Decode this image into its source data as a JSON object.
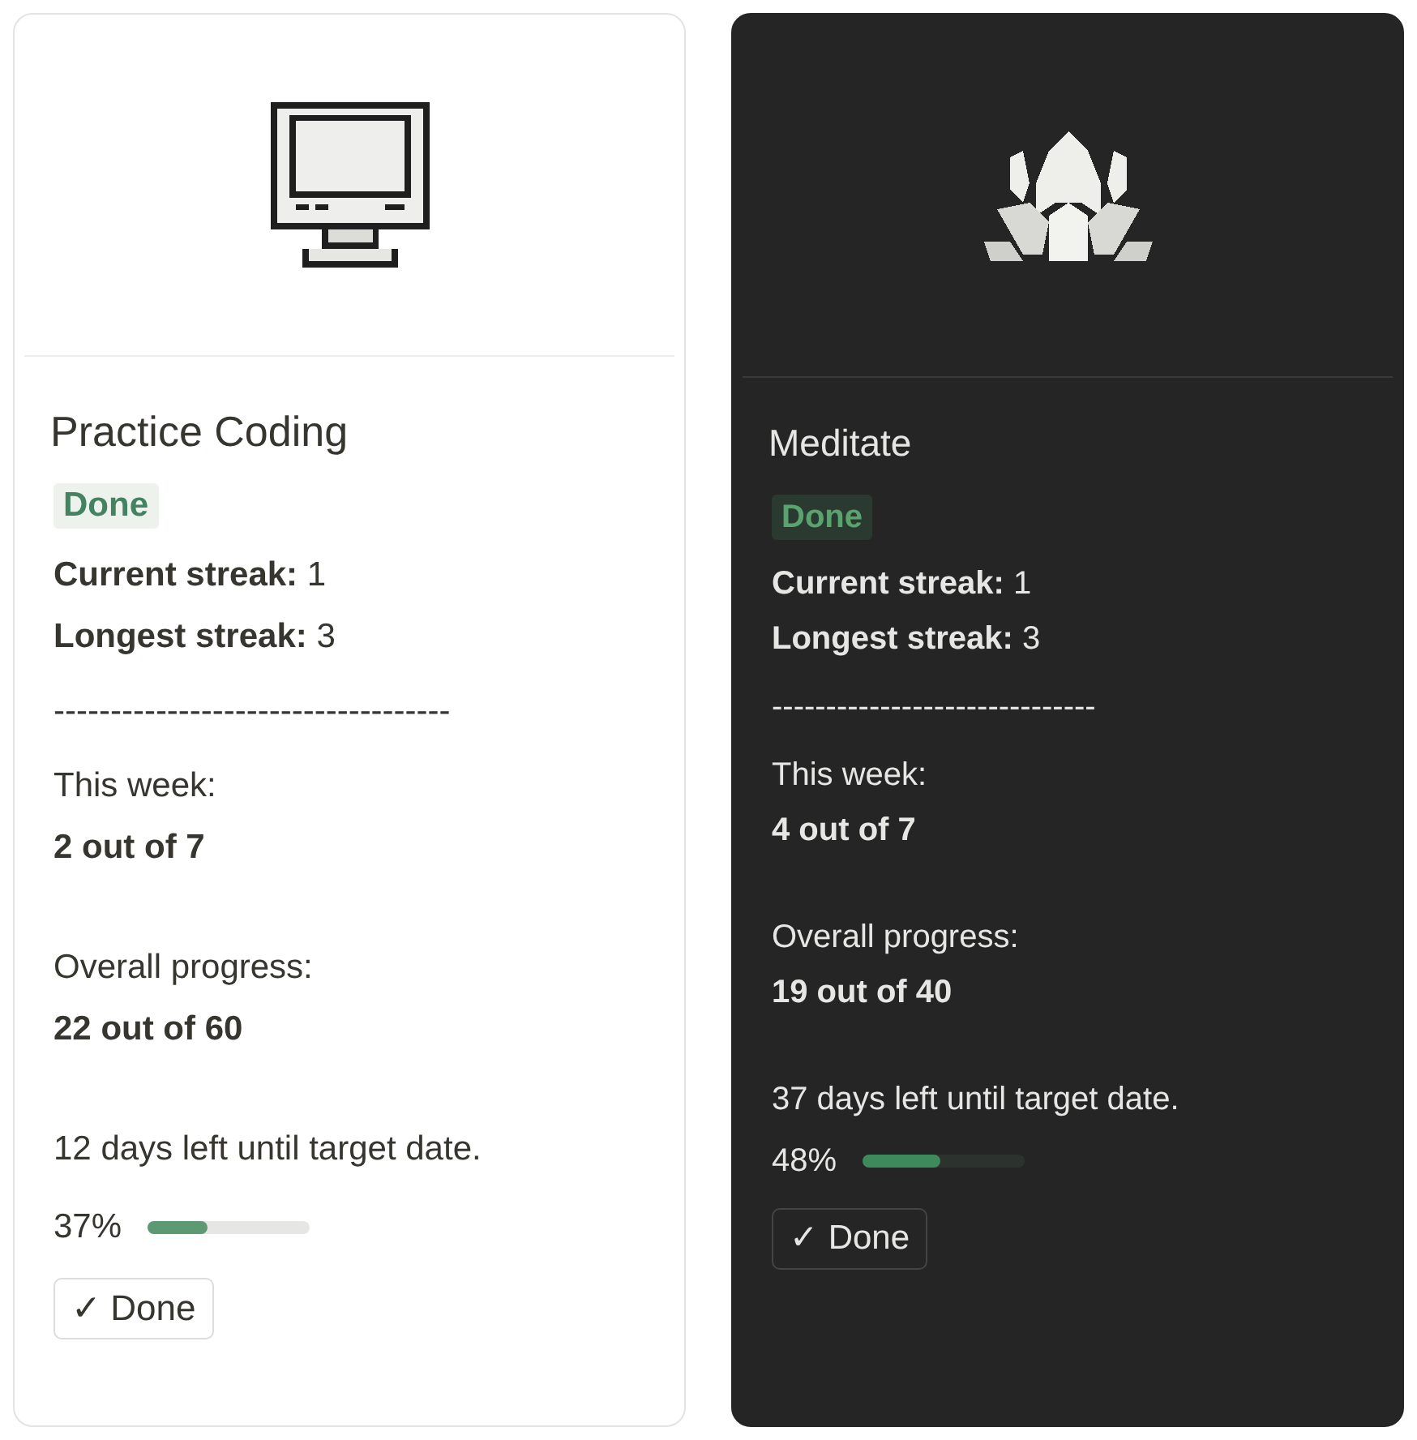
{
  "cards": [
    {
      "kind": "light",
      "title": "Practice Coding",
      "status": "Done",
      "current_label": "Current streak:",
      "current": "1",
      "longest_label": "Longest streak:",
      "longest": "3",
      "divider": "-----------------------------------",
      "week_label": "This week:",
      "week": "2 out of 7",
      "overall_label": "Overall progress:",
      "overall": "22 out of 60",
      "days_left": "12 days left until target date.",
      "percent": "37%",
      "level": 0.37,
      "button": "✓ Done"
    },
    {
      "kind": "dark",
      "title": "Meditate",
      "status": "Done",
      "current_label": "Current streak:",
      "current": "1",
      "longest_label": "Longest streak:",
      "longest": "3",
      "divider": "------------------------------",
      "week_label": "This week:",
      "week": "4 out of 7",
      "overall_label": "Overall progress:",
      "overall": "19 out of 40",
      "days_left": "37 days left until target date.",
      "percent": "48%",
      "level": 0.48,
      "button": "✓ Done"
    }
  ]
}
